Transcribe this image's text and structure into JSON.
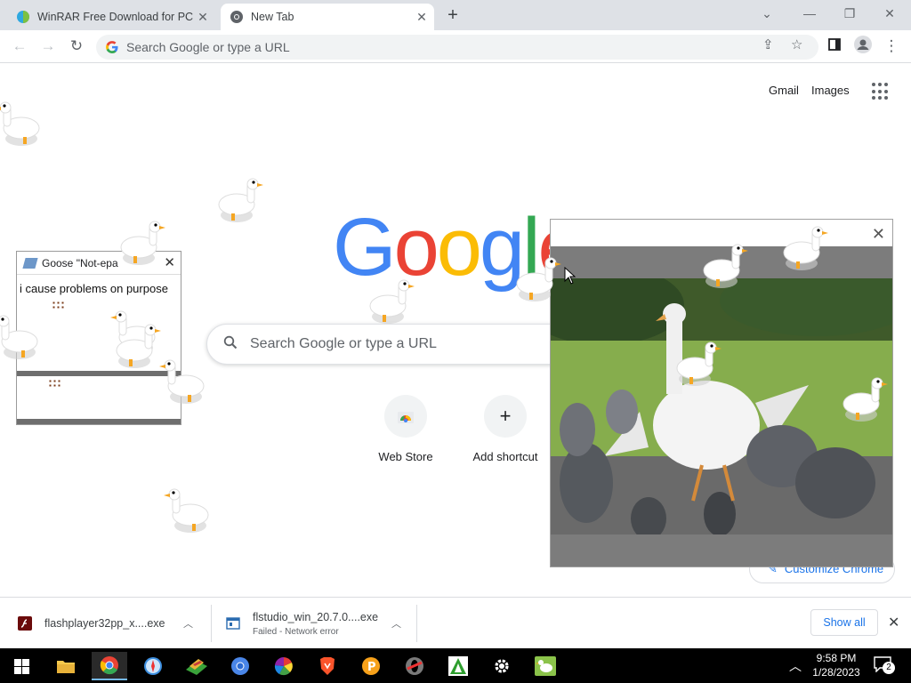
{
  "browser": {
    "tabs": [
      {
        "title": "WinRAR Free Download for PC",
        "active": false
      },
      {
        "title": "New Tab",
        "active": true
      }
    ],
    "omnibox_placeholder": "Search Google or type a URL"
  },
  "newtab": {
    "links": {
      "gmail": "Gmail",
      "images": "Images"
    },
    "logo_letters": [
      "G",
      "o",
      "o",
      "g",
      "l",
      "e"
    ],
    "logo_colors": [
      "#4285f4",
      "#ea4335",
      "#fbbc05",
      "#4285f4",
      "#34a853",
      "#ea4335"
    ],
    "search_placeholder": "Search Google or type a URL",
    "shortcuts": [
      {
        "label": "Web Store",
        "icon": "chrome-web-store-icon"
      },
      {
        "label": "Add shortcut",
        "icon": "plus-icon"
      }
    ],
    "customize_label": "Customize Chrome"
  },
  "goose_note": {
    "title": "Goose \"Not-epa",
    "text": "i cause problems on purpose"
  },
  "downloads": {
    "items": [
      {
        "name": "flashplayer32pp_x....exe",
        "status": ""
      },
      {
        "name": "flstudio_win_20.7.0....exe",
        "status": "Failed - Network error"
      }
    ],
    "show_all": "Show all"
  },
  "taskbar": {
    "apps": [
      "file-explorer-icon",
      "chrome-icon",
      "safari-icon",
      "winrar-icon",
      "chromium-icon",
      "color-wheel-icon",
      "brave-icon",
      "pastebin-icon",
      "opera-icon",
      "arch-icon",
      "settings-icon",
      "desktop-goose-icon"
    ],
    "time": "9:58 PM",
    "date": "1/28/2023",
    "notification_count": "2"
  }
}
